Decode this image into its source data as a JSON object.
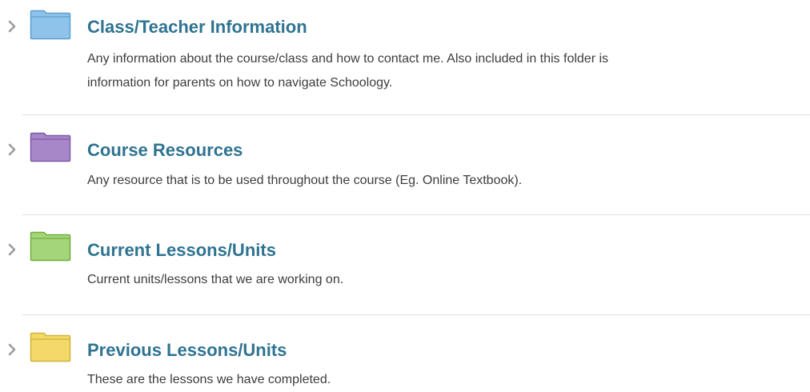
{
  "folders": [
    {
      "title": "Class/Teacher Information",
      "description_lines": [
        "Any information about the course/class and how to contact me.  Also included in this folder is",
        "information for parents on how to navigate Schoology."
      ],
      "color": "#8fc3ea",
      "icon": "folder-blue"
    },
    {
      "title": "Course Resources",
      "description_lines": [
        "Any resource that is to be used throughout the course (Eg. Online Textbook)."
      ],
      "color": "#a887c9",
      "icon": "folder-purple"
    },
    {
      "title": "Current Lessons/Units",
      "description_lines": [
        "Current units/lessons that we are working on."
      ],
      "color": "#a5d57a",
      "icon": "folder-green"
    },
    {
      "title": "Previous Lessons/Units",
      "description_lines": [
        "These are the lessons we have completed."
      ],
      "color": "#f3d96a",
      "icon": "folder-yellow"
    }
  ],
  "expand_icon": "chevron-right-icon"
}
